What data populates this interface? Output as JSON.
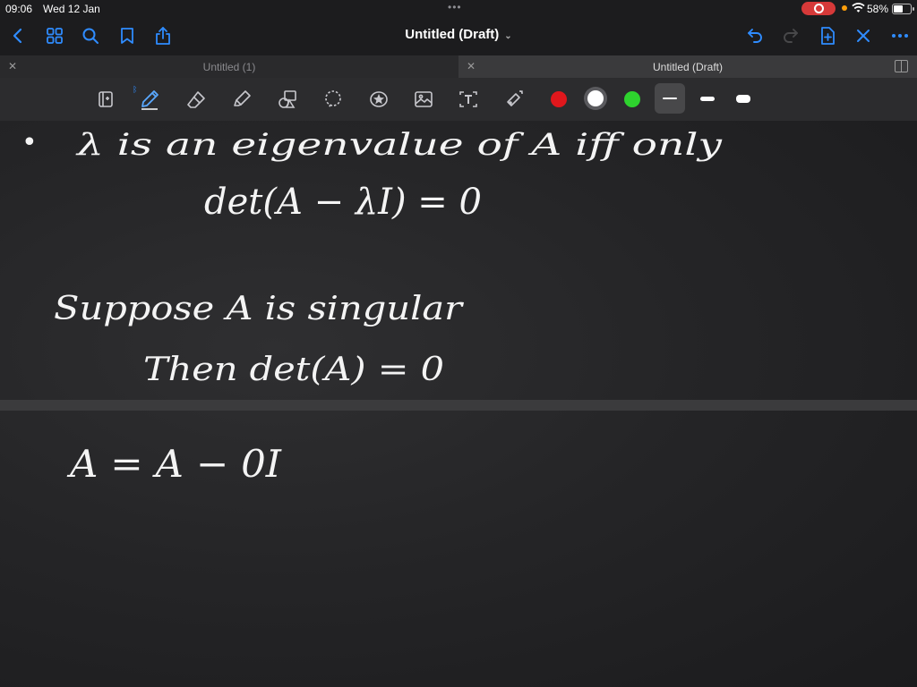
{
  "status_bar": {
    "time": "09:06",
    "date": "Wed 12 Jan",
    "battery_percent": "58%",
    "battery_level": 0.58,
    "recording": true
  },
  "nav": {
    "title": "Untitled (Draft)",
    "icons": [
      "back-chevron-icon",
      "grid-icon",
      "search-icon",
      "bookmark-icon",
      "share-icon",
      "undo-icon",
      "redo-icon",
      "add-page-icon",
      "close-icon",
      "more-icon"
    ]
  },
  "tabs": [
    {
      "label": "Untitled (1)",
      "active": false
    },
    {
      "label": "Untitled (Draft)",
      "active": true
    }
  ],
  "toolbar": {
    "tools": [
      "page-view-icon",
      "pen-icon",
      "eraser-icon",
      "highlighter-icon",
      "shapes-icon",
      "lasso-icon",
      "sticker-icon",
      "image-icon",
      "text-icon",
      "laser-pointer-icon"
    ],
    "selected_tool": "pen-icon",
    "colors": [
      "#e0171c",
      "#ffffff",
      "#2ed32e"
    ],
    "selected_color": "#ffffff",
    "thickness_options": [
      "thin",
      "medium",
      "thick"
    ],
    "selected_thickness": "thin"
  },
  "notes": {
    "page1": {
      "bullet": "•",
      "line1": "λ   is   an   eigenvalue   of    A   iff only",
      "line2": "det(A − λI) = 0",
      "line3": "Suppose    A    is    singular",
      "line4": "Then    det(A) = 0"
    },
    "page2": {
      "line1": "A = A − 0I"
    }
  }
}
